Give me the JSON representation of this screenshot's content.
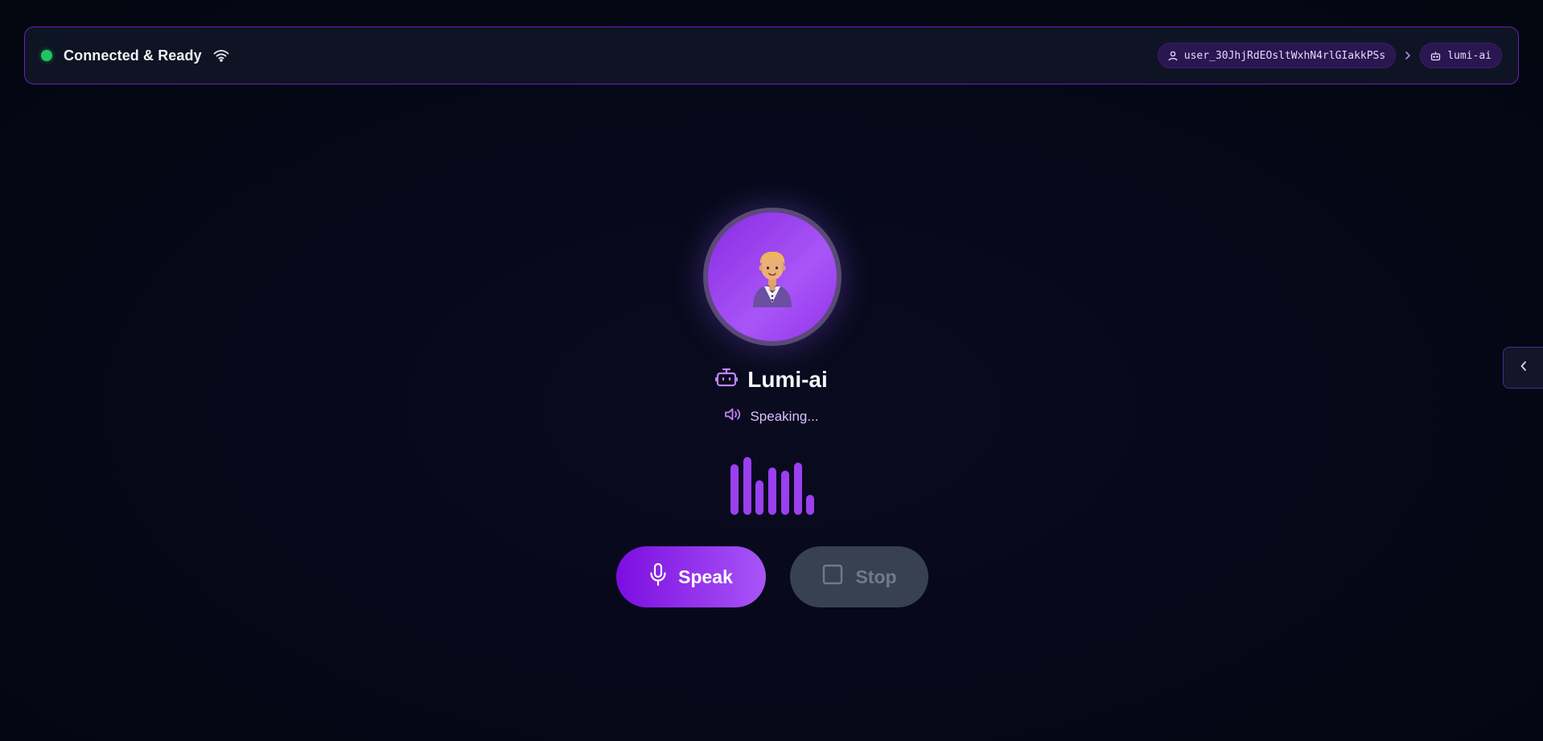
{
  "header": {
    "status_text": "Connected & Ready",
    "status_color": "#22c55e",
    "status_icon": "wifi-icon",
    "user_chip": {
      "icon": "user-icon",
      "label": "user_30JhjRdEOsltWxhN4rlGIakkPSs"
    },
    "separator_icon": "chevron-right-icon",
    "agent_chip": {
      "icon": "bot-icon",
      "label": "lumi-ai"
    }
  },
  "agent": {
    "avatar": "🤵",
    "name_icon": "bot-icon",
    "name": "Lumi-ai",
    "state_icon": "speaker-icon",
    "state_text": "Speaking..."
  },
  "audio_levels": [
    0.88,
    1.0,
    0.6,
    0.82,
    0.77,
    0.9,
    0.35
  ],
  "controls": {
    "speak_label": "Speak",
    "speak_icon": "microphone-icon",
    "stop_label": "Stop",
    "stop_icon": "stop-square-icon",
    "stop_disabled": true
  },
  "side_panel": {
    "toggle_icon": "chevron-left-icon"
  },
  "colors": {
    "accent": "#a855f7",
    "accent_dark": "#7c0ee0",
    "border": "#6a21b8",
    "background": "#050714"
  }
}
